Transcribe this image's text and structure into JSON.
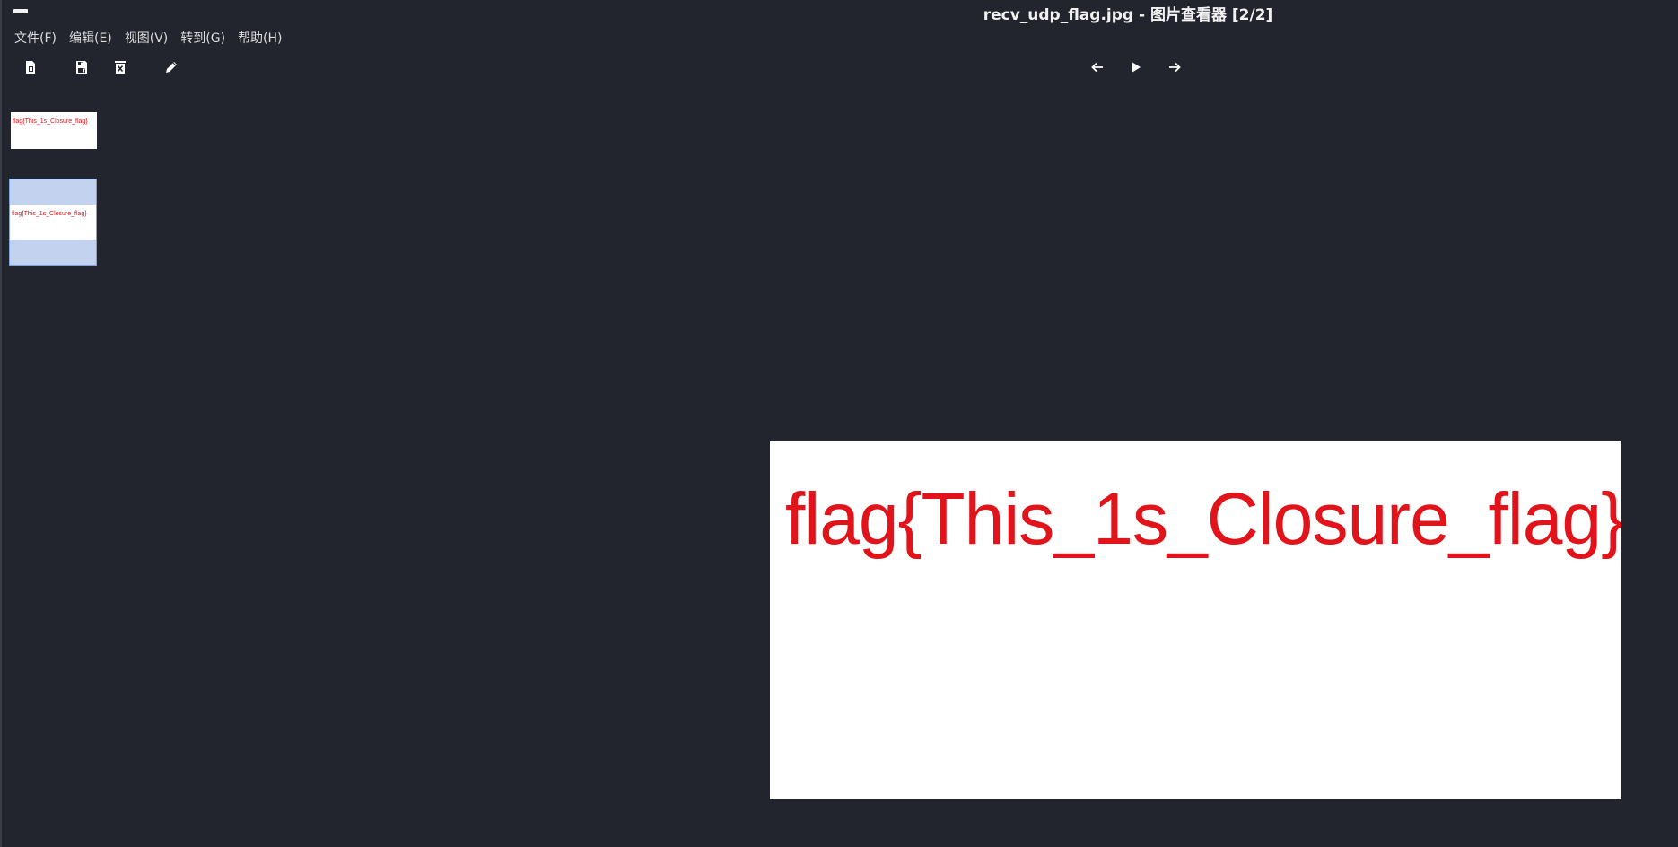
{
  "window": {
    "title": "recv_udp_flag.jpg - 图片查看器 [2/2]"
  },
  "menu": {
    "items": [
      {
        "label": "文件(F)"
      },
      {
        "label": "编辑(E)"
      },
      {
        "label": "视图(V)"
      },
      {
        "label": "转到(G)"
      },
      {
        "label": "帮助(H)"
      }
    ]
  },
  "toolbar": {
    "left_icons": [
      "open-file-icon",
      "save-as-icon",
      "delete-icon",
      "edit-icon"
    ],
    "nav_icons": [
      "arrow-left-icon",
      "play-icon",
      "arrow-right-icon"
    ]
  },
  "thumbnails": [
    {
      "text": "flag{This_1s_Closure_flag}",
      "selected": false
    },
    {
      "text": "flag{This_1s_Closure_flag}",
      "selected": true
    }
  ],
  "image": {
    "text": "flag{This_1s_Closure_flag}",
    "text_color": "#e0141a",
    "background": "#ffffff"
  },
  "colors": {
    "window_bg": "#23252e",
    "selection": "#c3d3ef",
    "selection_border": "#7ea0dd"
  }
}
